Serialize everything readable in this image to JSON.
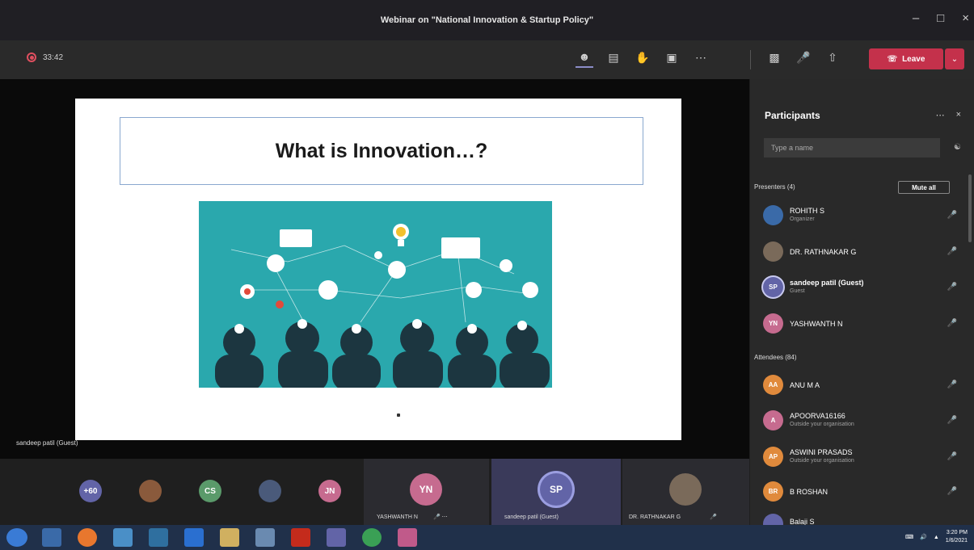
{
  "window": {
    "title": "Webinar on \"National Innovation & Startup Policy\""
  },
  "toolbar": {
    "timer": "33:42",
    "leave_label": "Leave"
  },
  "slide": {
    "title": "What is Innovation…?"
  },
  "presenter_label": "sandeep patil (Guest)",
  "gallery": {
    "overflow_count": "+60",
    "avatars": [
      {
        "initials": "CS"
      },
      {
        "initials": "JN"
      }
    ],
    "tiles": [
      {
        "initials": "YN",
        "name": "YASHWANTH N"
      },
      {
        "initials": "SP",
        "name": "sandeep patil (Guest)"
      },
      {
        "name": "DR. RATHNAKAR G"
      }
    ]
  },
  "participants": {
    "title": "Participants",
    "search_placeholder": "Type a name",
    "presenters_label": "Presenters (4)",
    "mute_all_label": "Mute all",
    "attendees_label": "Attendees (84)",
    "presenters": [
      {
        "name": "ROHITH S",
        "role": "Organizer"
      },
      {
        "name": "DR. RATHNAKAR G"
      },
      {
        "initials": "SP",
        "name": "sandeep patil (Guest)",
        "role": "Guest"
      },
      {
        "initials": "YN",
        "name": "YASHWANTH N"
      }
    ],
    "attendees": [
      {
        "initials": "AA",
        "name": "ANU M A"
      },
      {
        "initials": "A",
        "name": "APOORVA16166",
        "role": "Outside your organisation"
      },
      {
        "initials": "AP",
        "name": "ASWINI PRASADS",
        "role": "Outside your organisation"
      },
      {
        "initials": "BR",
        "name": "B ROSHAN"
      },
      {
        "name": "Balaji S"
      }
    ]
  },
  "taskbar": {
    "time": "3:20 PM",
    "date": "1/6/2021"
  },
  "colors": {
    "leave_red": "#c4314b",
    "teams_purple": "#6264a7",
    "slide_teal": "#2aa8ad",
    "avatar_orange": "#e08a3c",
    "avatar_pink": "#c66b8f"
  }
}
